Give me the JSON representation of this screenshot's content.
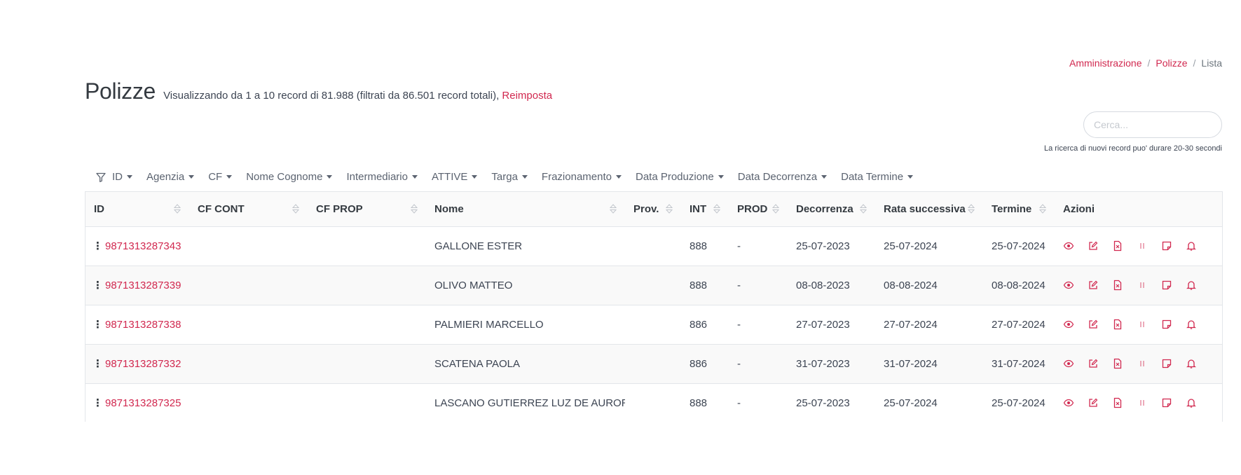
{
  "breadcrumb": {
    "items": [
      "Amministrazione",
      "Polizze"
    ],
    "current": "Lista",
    "separator": "/"
  },
  "header": {
    "title": "Polizze",
    "summary": "Visualizzando da 1 a 10 record di 81.988 (filtrati da 86.501 record totali),",
    "reset_label": "Reimposta"
  },
  "search": {
    "placeholder": "Cerca...",
    "value": "",
    "hint": "La ricerca di nuovi record puo' durare 20-30 secondi"
  },
  "filters": [
    "ID",
    "Agenzia",
    "CF",
    "Nome Cognome",
    "Intermediario",
    "ATTIVE",
    "Targa",
    "Frazionamento",
    "Data Produzione",
    "Data Decorrenza",
    "Data Termine"
  ],
  "table": {
    "columns": [
      "ID",
      "CF CONT",
      "CF PROP",
      "Nome",
      "Prov.",
      "INT",
      "PROD",
      "Decorrenza",
      "Rata successiva",
      "Termine",
      "Azioni"
    ],
    "rows": [
      {
        "id": "9871313287343",
        "cf_cont": "",
        "cf_prop": "",
        "nome": "GALLONE ESTER",
        "prov": "",
        "int": "888",
        "prod": "-",
        "decorrenza": "25-07-2023",
        "rata": "25-07-2024",
        "termine": "25-07-2024"
      },
      {
        "id": "9871313287339",
        "cf_cont": "",
        "cf_prop": "",
        "nome": "OLIVO MATTEO",
        "prov": "",
        "int": "888",
        "prod": "-",
        "decorrenza": "08-08-2023",
        "rata": "08-08-2024",
        "termine": "08-08-2024"
      },
      {
        "id": "9871313287338",
        "cf_cont": "",
        "cf_prop": "",
        "nome": "PALMIERI MARCELLO",
        "prov": "",
        "int": "886",
        "prod": "-",
        "decorrenza": "27-07-2023",
        "rata": "27-07-2024",
        "termine": "27-07-2024"
      },
      {
        "id": "9871313287332",
        "cf_cont": "",
        "cf_prop": "",
        "nome": "SCATENA PAOLA",
        "prov": "",
        "int": "886",
        "prod": "-",
        "decorrenza": "31-07-2023",
        "rata": "31-07-2024",
        "termine": "31-07-2024"
      },
      {
        "id": "9871313287325",
        "cf_cont": "",
        "cf_prop": "",
        "nome": "LASCANO GUTIERREZ LUZ DE AURORA",
        "prov": "",
        "int": "888",
        "prod": "-",
        "decorrenza": "25-07-2023",
        "rata": "25-07-2024",
        "termine": "25-07-2024"
      }
    ],
    "row_actions": [
      "eye-icon",
      "edit-icon",
      "pdf-file-icon",
      "pause-icon",
      "note-icon",
      "bell-icon"
    ]
  },
  "colors": {
    "accent": "#d1284f",
    "text": "#3c4452",
    "border": "#e3e6ea",
    "header_bg": "#fafafa",
    "row_alt_bg": "#f9f9f9"
  }
}
